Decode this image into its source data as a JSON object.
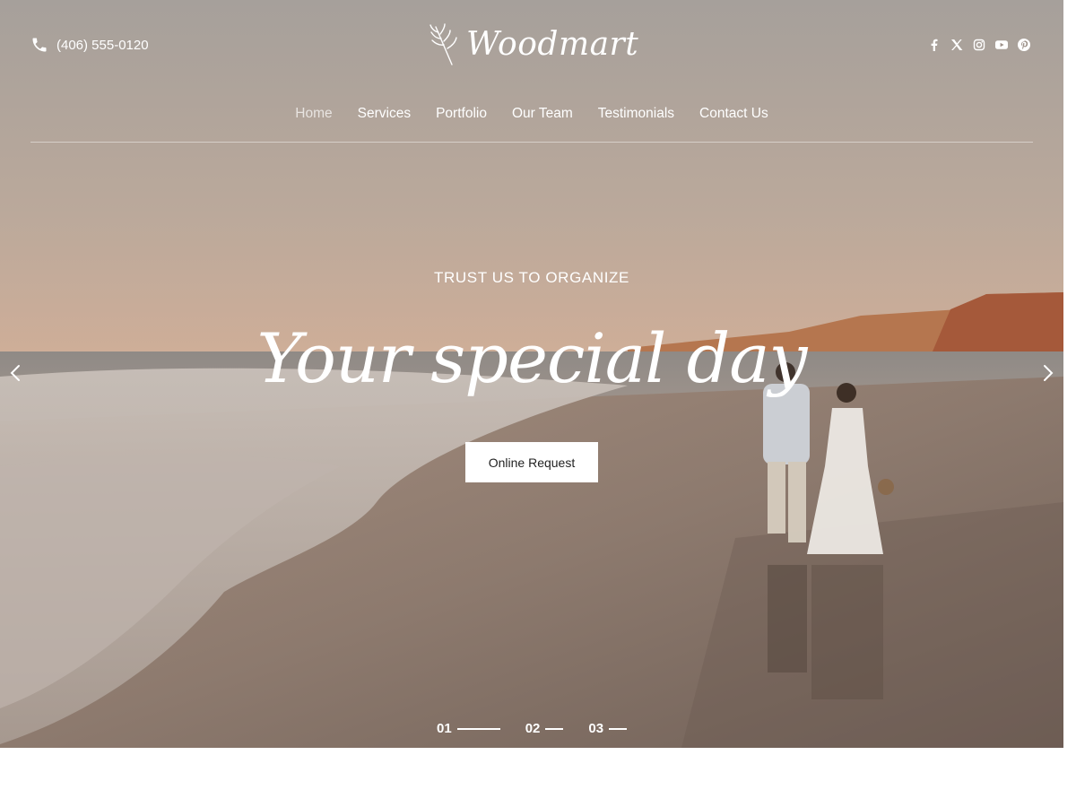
{
  "header": {
    "phone": "(406) 555-0120",
    "logo_text": "Woodmart",
    "socials": [
      "facebook-icon",
      "x-icon",
      "instagram-icon",
      "youtube-icon",
      "pinterest-icon"
    ]
  },
  "nav": {
    "items": [
      {
        "label": "Home",
        "active": true
      },
      {
        "label": "Services",
        "active": false
      },
      {
        "label": "Portfolio",
        "active": false
      },
      {
        "label": "Our Team",
        "active": false
      },
      {
        "label": "Testimonials",
        "active": false
      },
      {
        "label": "Contact Us",
        "active": false
      }
    ]
  },
  "hero": {
    "eyebrow": "TRUST US TO ORGANIZE",
    "headline": "Your special day",
    "cta_label": "Online Request",
    "slides": [
      "01",
      "02",
      "03"
    ],
    "active_slide": "01"
  },
  "colors": {
    "text": "#ffffff",
    "button_bg": "#ffffff",
    "button_text": "#222222"
  }
}
